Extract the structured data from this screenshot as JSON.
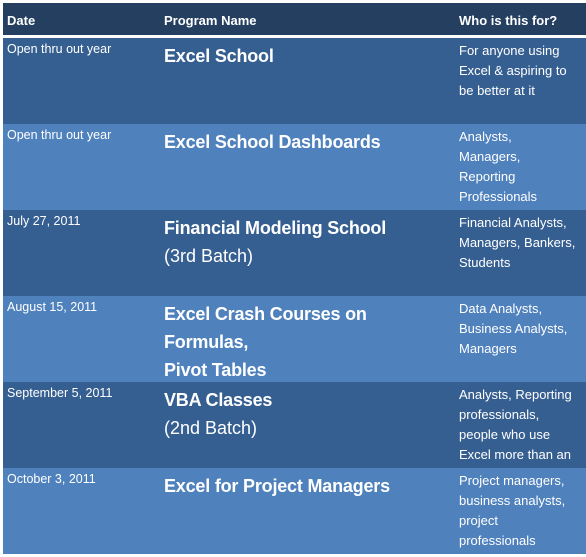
{
  "colors": {
    "header_bg": "#243f60",
    "row_dark": "#365f91",
    "row_light": "#4f81bd",
    "text": "#ffffff"
  },
  "table": {
    "headers": {
      "date": "Date",
      "program": "Program Name",
      "audience": "Who is this for?"
    },
    "rows": [
      {
        "date": "Open thru out year",
        "program_title": "Excel School",
        "program_subtitle": "",
        "audience_lines": [
          "For anyone using",
          "Excel & aspiring to",
          "be better at it"
        ]
      },
      {
        "date": "Open thru out year",
        "program_title": "Excel School Dashboards",
        "program_subtitle": "",
        "audience_lines": [
          "Analysts,",
          "Managers,",
          "Reporting",
          "Professionals"
        ]
      },
      {
        "date": "July 27, 2011",
        "program_title": "Financial Modeling School",
        "program_subtitle": "(3rd Batch)",
        "audience_lines": [
          "Financial Analysts,",
          "Managers, Bankers,",
          "Students"
        ]
      },
      {
        "date": "August 15, 2011",
        "program_title": "Excel Crash Courses on Formulas,",
        "program_title_line2": "Pivot Tables",
        "program_subtitle": "",
        "audience_lines": [
          "Data Analysts,",
          "Business Analysts,",
          "Managers"
        ]
      },
      {
        "date": "September 5, 2011",
        "program_title": "VBA Classes",
        "program_subtitle": "(2nd Batch)",
        "audience_lines": [
          "Analysts, Reporting",
          "professionals,",
          "people who use",
          "Excel more than an"
        ]
      },
      {
        "date": "October 3, 2011",
        "program_title": "Excel for Project Managers",
        "program_subtitle": "",
        "audience_lines": [
          "Project managers,",
          "business analysts,",
          "project",
          "professionals"
        ]
      }
    ]
  }
}
